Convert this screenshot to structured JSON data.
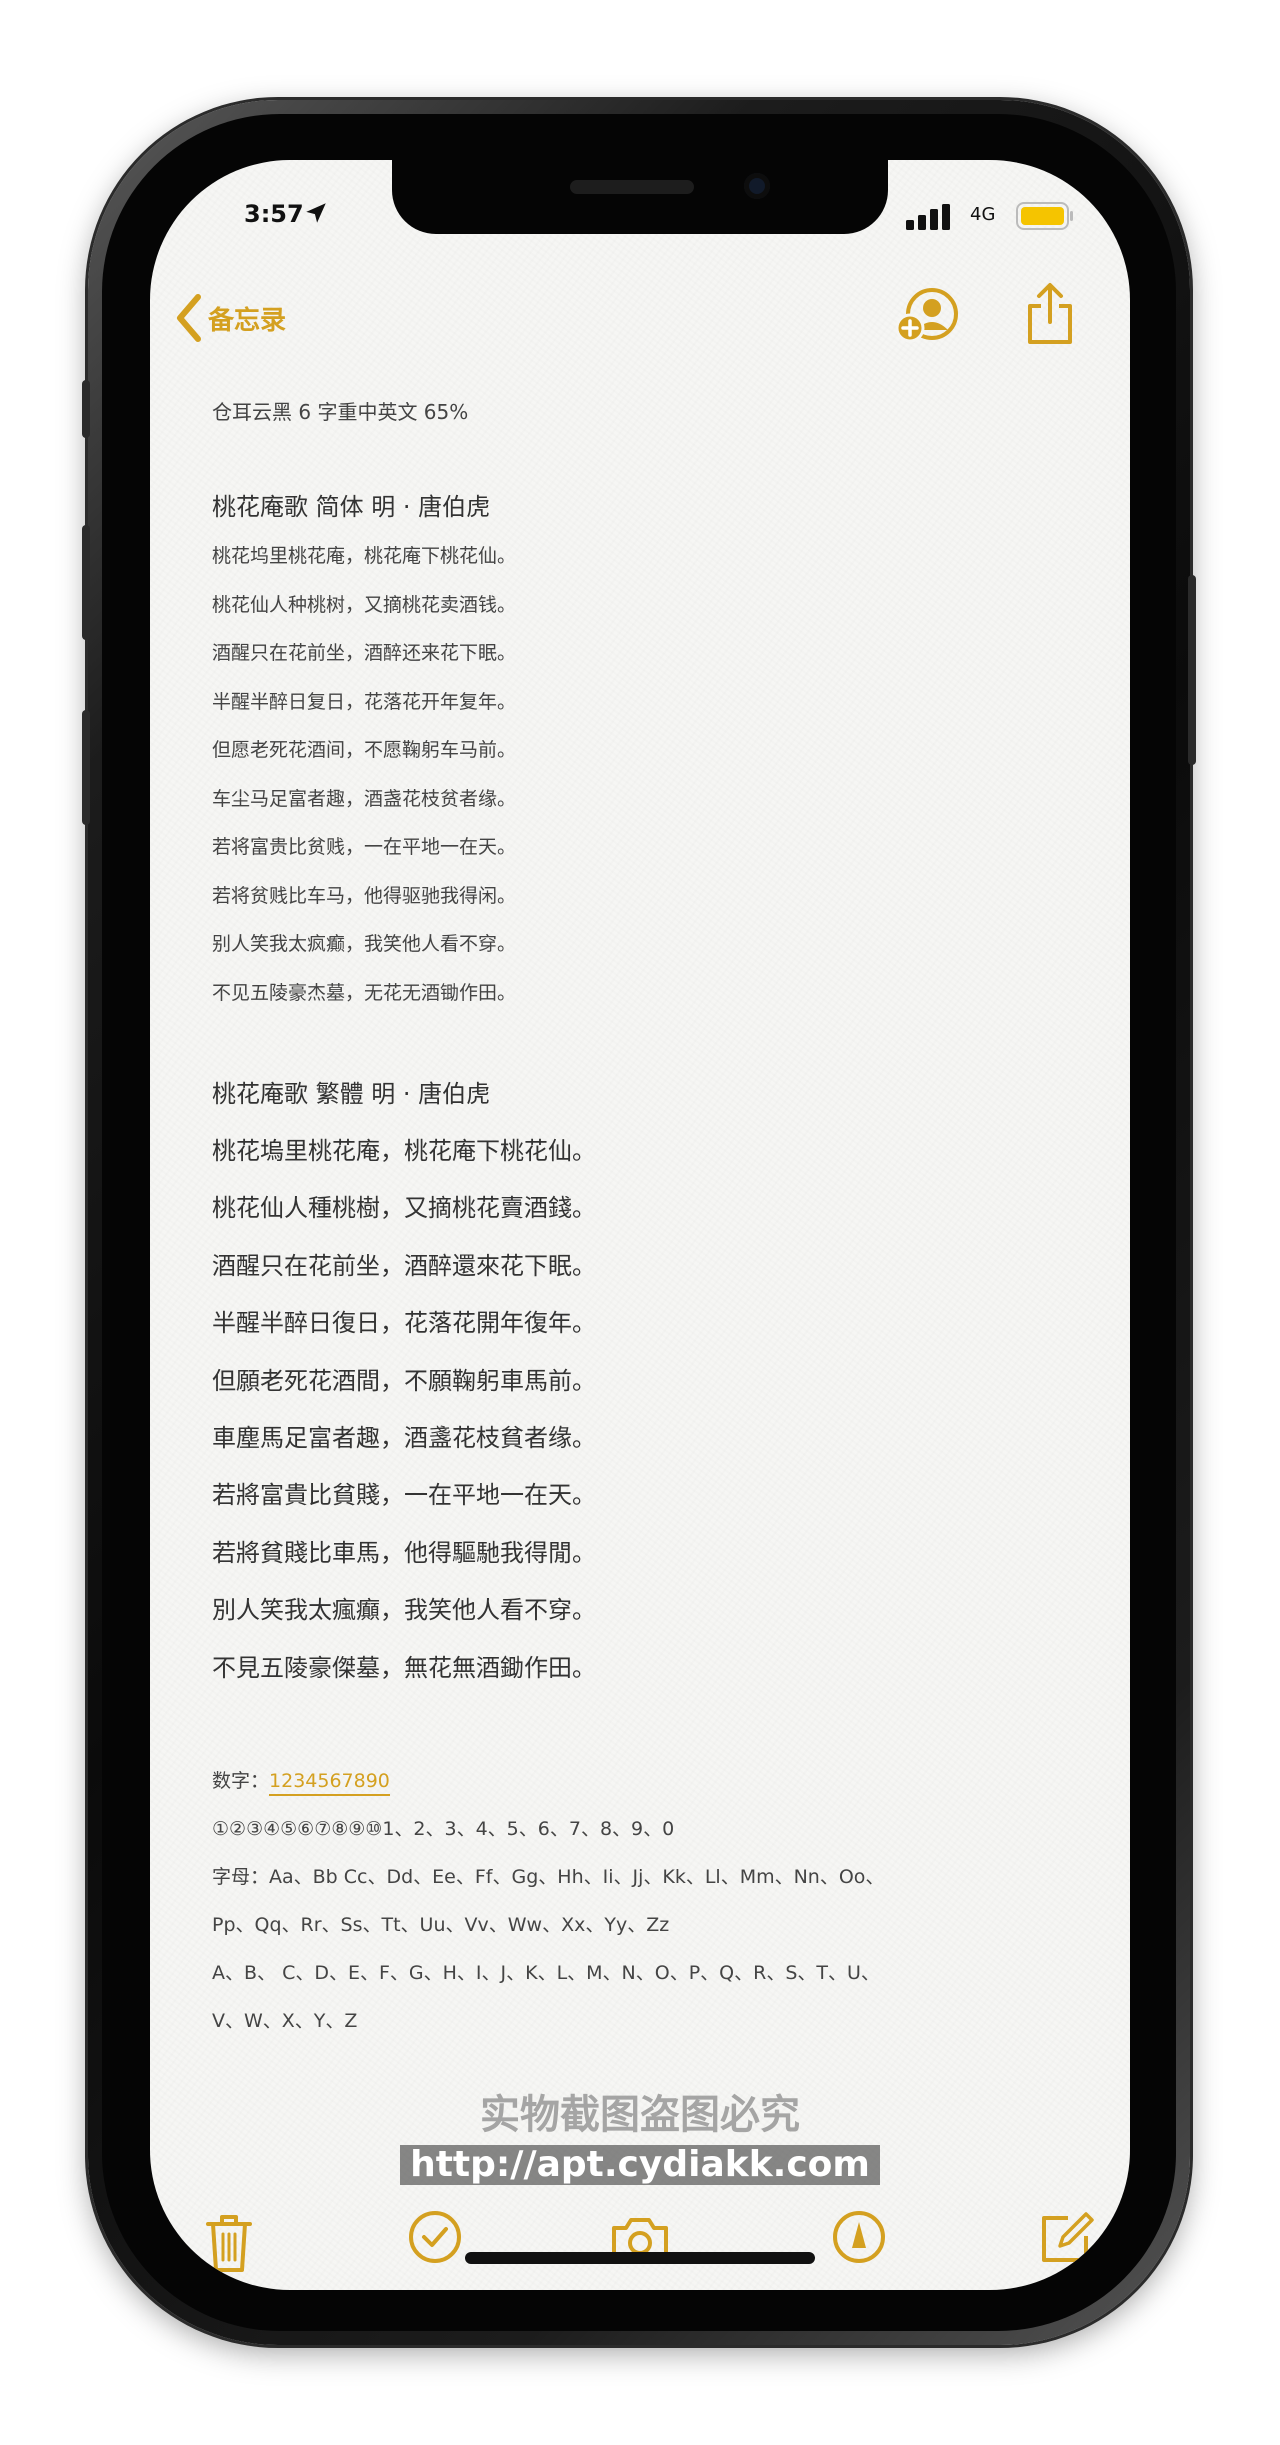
{
  "status": {
    "time": "3:57",
    "network": "4G"
  },
  "nav": {
    "back_label": "备忘录"
  },
  "note": {
    "meta": "仓耳云黑 6 字重中英文 65%",
    "simplified_title": "桃花庵歌  简体   明  ·  唐伯虎",
    "simplified_lines": [
      "桃花坞里桃花庵，桃花庵下桃花仙。",
      "桃花仙人种桃树，又摘桃花卖酒钱。",
      "酒醒只在花前坐，酒醉还来花下眠。",
      "半醒半醉日复日，花落花开年复年。",
      "但愿老死花酒间，不愿鞠躬车马前。",
      "车尘马足富者趣，酒盏花枝贫者缘。",
      "若将富贵比贫贱，一在平地一在天。",
      "若将贫贱比车马，他得驱驰我得闲。",
      "别人笑我太疯癫，我笑他人看不穿。",
      "不见五陵豪杰墓，无花无酒锄作田。"
    ],
    "traditional_title": "桃花庵歌  繁體      明  ·  唐伯虎",
    "traditional_lines": [
      "桃花塢里桃花庵，桃花庵下桃花仙。",
      "桃花仙人種桃樹，又摘桃花賣酒錢。",
      "酒醒只在花前坐，酒醉還來花下眠。",
      "半醒半醉日復日，花落花開年復年。",
      "但願老死花酒間，不願鞠躬車馬前。",
      "車塵馬足富者趣，酒盞花枝貧者缘。",
      "若將富貴比貧賤，一在平地一在天。",
      "若將貧賤比車馬，他得驅馳我得閒。",
      "別人笑我太瘋癲，我笑他人看不穿。",
      "不見五陵豪傑墓，無花無酒鋤作田。"
    ],
    "digits_label": "数字：",
    "digits_value": "1234567890",
    "digits_line": "①②③④⑤⑥⑦⑧⑨⑩1、2、3、4、5、6、7、8、9、0",
    "letters_line1": "字母：Aa、Bb Cc、Dd、Ee、Ff、Gg、Hh、Ii、Jj、Kk、Ll、Mm、Nn、Oo、",
    "letters_line2": "Pp、Qq、Rr、Ss、Tt、Uu、Vv、Ww、Xx、Yy、Zz",
    "letters_line3": "A、B、 C、D、E、F、G、H、I、J、K、L、M、N、O、P、Q、R、S、T、U、",
    "letters_line4": "V、W、X、Y、Z"
  },
  "watermark": {
    "line1": "实物截图盗图必究",
    "line2": "http://apt.cydiakk.com"
  },
  "colors": {
    "accent": "#d4a020",
    "paper": "#f6f6f4"
  },
  "icons": [
    "location-arrow-icon",
    "signal-icon",
    "battery-icon",
    "chevron-left-icon",
    "add-person-icon",
    "share-icon",
    "trash-icon",
    "checklist-icon",
    "camera-icon",
    "markup-icon",
    "compose-icon"
  ]
}
